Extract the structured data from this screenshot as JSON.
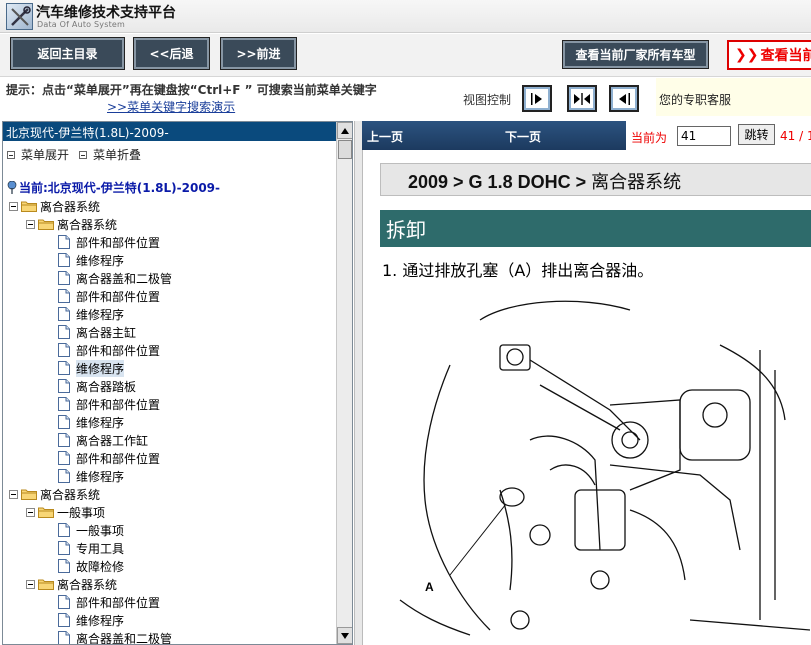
{
  "app": {
    "title": "汽车维修技术支持平台",
    "subtitle": "Data Of Auto System"
  },
  "toolbar": {
    "home_label": "返回主目录",
    "back_label": "<<后退",
    "forward_label": ">>前进",
    "view_models_label": "查看当前厂家所有车型",
    "red_button_label": "查看当前"
  },
  "hint": {
    "text": "提示：点击“菜单展开”再在键盘按“Ctrl+F ” 可搜索当前菜单关键字",
    "link": ">>菜单关键字搜索演示",
    "view_control_label": "视图控制",
    "support_label": "您的专职客服"
  },
  "left_panel": {
    "header": "北京现代-伊兰特(1.8L)-2009-",
    "expand_label": "菜单展开",
    "collapse_label": "菜单折叠",
    "current": "当前:北京现代-伊兰特(1.8L)-2009-",
    "tree": [
      {
        "level": 0,
        "type": "folder",
        "label": "离合器系统"
      },
      {
        "level": 1,
        "type": "folder",
        "label": "离合器系统"
      },
      {
        "level": 2,
        "type": "doc",
        "label": "部件和部件位置"
      },
      {
        "level": 2,
        "type": "doc",
        "label": "维修程序"
      },
      {
        "level": 2,
        "type": "doc",
        "label": "离合器盖和二极管"
      },
      {
        "level": 2,
        "type": "doc",
        "label": "部件和部件位置"
      },
      {
        "level": 2,
        "type": "doc",
        "label": "维修程序"
      },
      {
        "level": 2,
        "type": "doc",
        "label": "离合器主缸"
      },
      {
        "level": 2,
        "type": "doc",
        "label": "部件和部件位置"
      },
      {
        "level": 2,
        "type": "doc",
        "label": "维修程序",
        "selected": true
      },
      {
        "level": 2,
        "type": "doc",
        "label": "离合器踏板"
      },
      {
        "level": 2,
        "type": "doc",
        "label": "部件和部件位置"
      },
      {
        "level": 2,
        "type": "doc",
        "label": "维修程序"
      },
      {
        "level": 2,
        "type": "doc",
        "label": "离合器工作缸"
      },
      {
        "level": 2,
        "type": "doc",
        "label": "部件和部件位置"
      },
      {
        "level": 2,
        "type": "doc",
        "label": "维修程序"
      },
      {
        "level": 0,
        "type": "folder",
        "label": "离合器系统"
      },
      {
        "level": 1,
        "type": "folder",
        "label": "一般事项"
      },
      {
        "level": 2,
        "type": "doc",
        "label": "一般事项"
      },
      {
        "level": 2,
        "type": "doc",
        "label": "专用工具"
      },
      {
        "level": 2,
        "type": "doc",
        "label": "故障检修"
      },
      {
        "level": 1,
        "type": "folder",
        "label": "离合器系统"
      },
      {
        "level": 2,
        "type": "doc",
        "label": "部件和部件位置"
      },
      {
        "level": 2,
        "type": "doc",
        "label": "维修程序"
      },
      {
        "level": 2,
        "type": "doc",
        "label": "离合器盖和二极管"
      }
    ]
  },
  "right_panel": {
    "prev_label": "上一页",
    "next_label": "下一页",
    "current_page_label": "当前为",
    "page_value": "41",
    "jump_label": "跳转",
    "total_text": "41 / 1",
    "breadcrumb_bold": "2009 > G 1.8 DOHC >",
    "breadcrumb_tail": " 离合器系统",
    "section_title": "拆卸",
    "step_text": "1. 通过排放孔塞（A）排出离合器油。",
    "figure_callout": "A"
  }
}
